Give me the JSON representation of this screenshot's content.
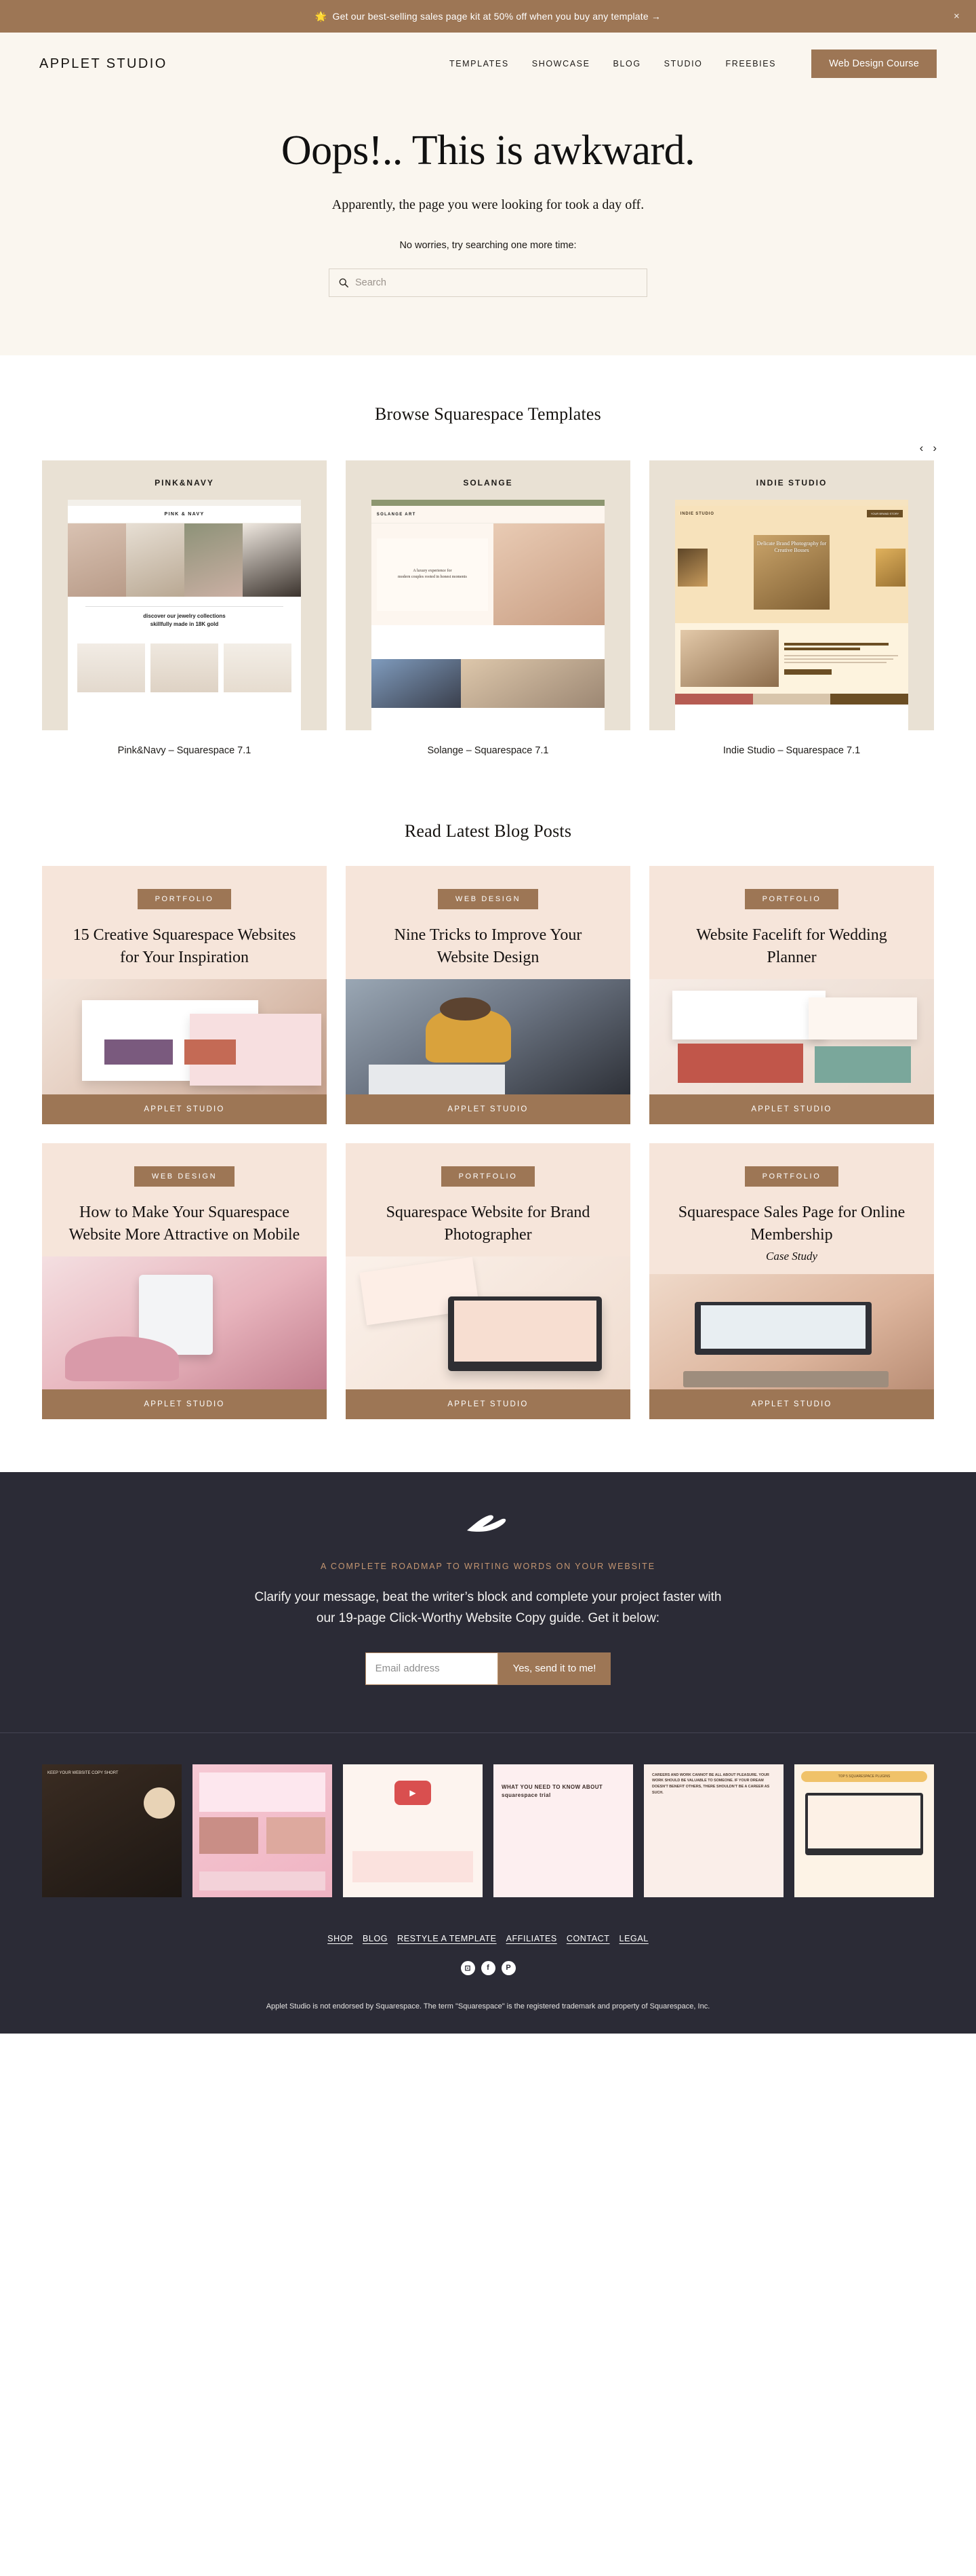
{
  "announcement": {
    "icon": "star-icon",
    "text": "Get our best-selling sales page kit at 50% off when you buy any template →",
    "close_label": "×"
  },
  "header": {
    "logo": "APPLET STUDIO",
    "nav": [
      {
        "label": "TEMPLATES"
      },
      {
        "label": "SHOWCASE"
      },
      {
        "label": "BLOG"
      },
      {
        "label": "STUDIO"
      },
      {
        "label": "FREEBIES"
      }
    ],
    "cta": "Web Design Course"
  },
  "hero": {
    "title": "Oops!.. This is awkward.",
    "subtitle": "Apparently, the page you were looking for took a day off.",
    "hint": "No worries, try searching one more time:",
    "search_placeholder": "Search",
    "search_value": "",
    "search_icon": "search-icon"
  },
  "templates": {
    "title": "Browse Squarespace Templates",
    "prev_icon": "chevron-left-icon",
    "next_icon": "chevron-right-icon",
    "items": [
      {
        "brand": "PINK&NAVY",
        "caption": "Pink&Navy – Squarespace 7.1",
        "mock_nav": "PINK & NAVY",
        "mock_headline_1": "discover our jewelry collections",
        "mock_headline_2": "skillfully made in 18K gold"
      },
      {
        "brand": "SOLANGE",
        "caption": "Solange – Squarespace 7.1",
        "mock_nav": "SOLANGE ART",
        "mock_headline_1": "A luxury experience for",
        "mock_headline_2": "modern couples rooted in honest moments"
      },
      {
        "brand": "INDIE STUDIO",
        "caption": "Indie Studio – Squarespace 7.1",
        "mock_nav": "INDIE STUDIO",
        "mock_headline_1": "Delicate Brand Photography for",
        "mock_headline_2": "Creative Bosses"
      }
    ]
  },
  "blog": {
    "title": "Read Latest Blog Posts",
    "posts": [
      {
        "tag": "PORTFOLIO",
        "title": "15 Creative Squarespace Websites for Your Inspiration",
        "subtitle": "",
        "footer": "APPLET STUDIO"
      },
      {
        "tag": "WEB DESIGN",
        "title": "Nine Tricks to Improve Your Website Design",
        "subtitle": "",
        "footer": "APPLET STUDIO"
      },
      {
        "tag": "PORTFOLIO",
        "title": "Website Facelift for Wedding Planner",
        "subtitle": "",
        "footer": "APPLET STUDIO"
      },
      {
        "tag": "WEB DESIGN",
        "title": "How to Make Your Squarespace Website More Attractive on Mobile",
        "subtitle": "",
        "footer": "APPLET STUDIO"
      },
      {
        "tag": "PORTFOLIO",
        "title": "Squarespace Website for Brand Photographer",
        "subtitle": "",
        "footer": "APPLET STUDIO"
      },
      {
        "tag": "PORTFOLIO",
        "title": "Squarespace Sales Page for Online Membership",
        "subtitle": "Case Study",
        "footer": "APPLET STUDIO"
      }
    ]
  },
  "cta": {
    "logo_icon": "brush-stroke-logo",
    "kicker": "A COMPLETE ROADMAP TO WRITING WORDS ON YOUR WEBSITE",
    "lead": "Clarify your message, beat the writer’s block and complete your project faster with our 19-page Click-Worthy Website Copy guide. Get it below:",
    "email_placeholder": "Email address",
    "email_value": "",
    "submit_label": "Yes, send it to me!"
  },
  "gallery": [
    {
      "caption": "KEEP YOUR WEBSITE COPY SHORT"
    },
    {
      "caption": ""
    },
    {
      "caption": ""
    },
    {
      "caption": "WHAT YOU NEED TO KNOW ABOUT squarespace trial"
    },
    {
      "caption": "CAREERS AND WORK CANNOT BE ALL ABOUT PLEASURE. YOUR WORK SHOULD BE VALUABLE TO SOMEONE. IF YOUR DREAM DOESN'T BENEFIT OTHERS, THERE SHOULDN'T BE A CAREER AS SUCH."
    },
    {
      "caption": "TOP 5 SQUARESPACE PLUGINS"
    }
  ],
  "footer": {
    "links": [
      {
        "label": "SHOP"
      },
      {
        "label": "BLOG"
      },
      {
        "label": "RESTYLE A TEMPLATE"
      },
      {
        "label": "AFFILIATES"
      },
      {
        "label": "CONTACT"
      },
      {
        "label": "LEGAL"
      }
    ],
    "socials": [
      {
        "name": "instagram-icon",
        "glyph": "⊡"
      },
      {
        "name": "facebook-icon",
        "glyph": "f"
      },
      {
        "name": "pinterest-icon",
        "glyph": "P"
      }
    ],
    "legal": "Applet Studio is not endorsed by Squarespace. The term \"Squarespace\" is the registered trademark and property of Squarespace, Inc."
  },
  "colors": {
    "accent": "#9d7655",
    "cream": "#faf6ef",
    "blush": "#f6e5da",
    "dark": "#2b2b36",
    "tan": "#e9e1d4"
  }
}
